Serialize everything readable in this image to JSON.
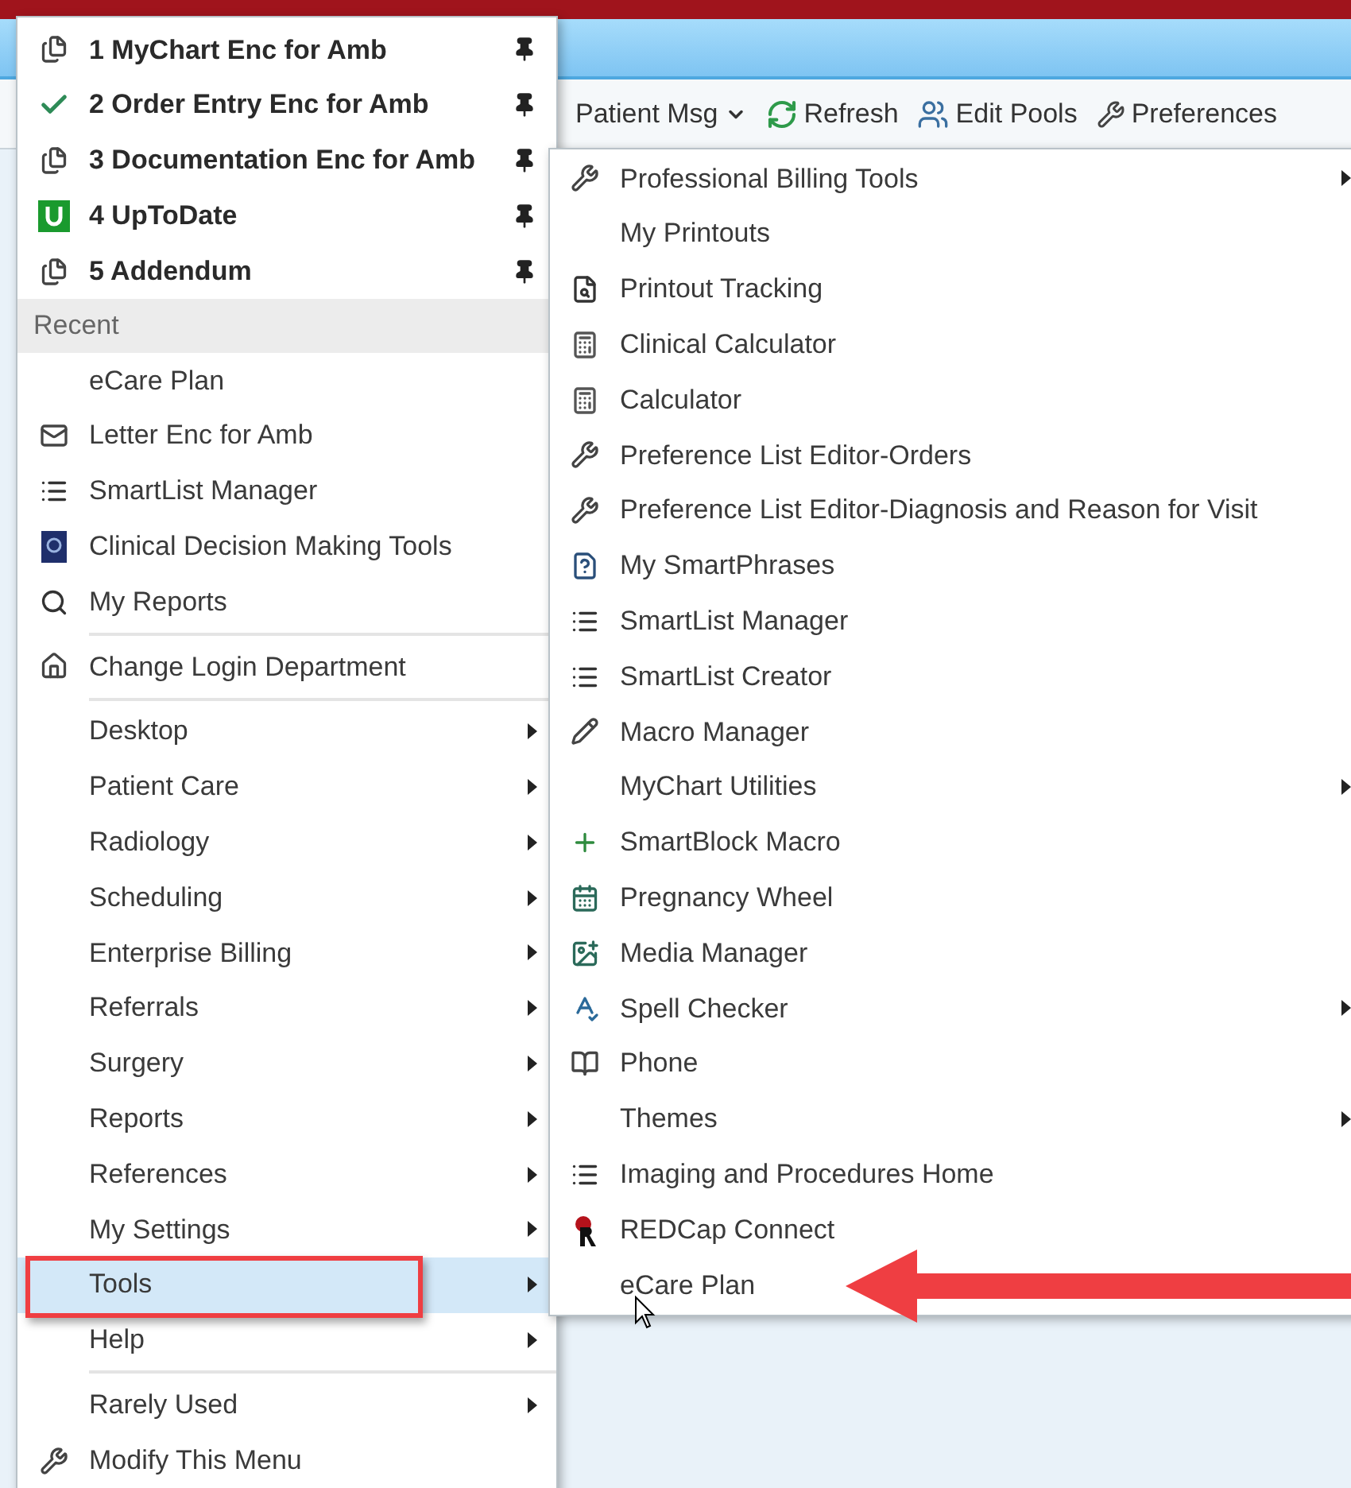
{
  "toolbar": {
    "items": [
      {
        "label": "Patient Msg",
        "kind": "dropdown"
      },
      {
        "label": "Refresh",
        "kind": "button"
      },
      {
        "label": "Edit Pools",
        "kind": "button"
      },
      {
        "label": "Preferences",
        "kind": "button"
      }
    ]
  },
  "main_menu": {
    "sections": [
      {
        "items": [
          {
            "label": "1 MyChart Enc for Amb",
            "kind": "pinned",
            "pinned": true,
            "checked": false,
            "selected": false,
            "submenu": false
          },
          {
            "label": "2 Order Entry Enc for Amb",
            "kind": "pinned",
            "pinned": true,
            "checked": true,
            "selected": false,
            "submenu": false
          },
          {
            "label": "3 Documentation Enc for Amb",
            "kind": "pinned",
            "pinned": true,
            "checked": false,
            "selected": false,
            "submenu": false
          },
          {
            "label": "4 UpToDate",
            "kind": "pinned",
            "pinned": true,
            "checked": false,
            "selected": false,
            "submenu": false
          },
          {
            "label": "5 Addendum",
            "kind": "pinned",
            "pinned": true,
            "checked": false,
            "selected": false,
            "submenu": false
          }
        ]
      },
      {
        "header": "Recent",
        "items": [
          {
            "label": "eCare Plan",
            "kind": "item",
            "selected": false,
            "submenu": false
          },
          {
            "label": "Letter Enc for Amb",
            "kind": "item",
            "selected": false,
            "submenu": false
          },
          {
            "label": "SmartList Manager",
            "kind": "item",
            "selected": false,
            "submenu": false
          },
          {
            "label": "Clinical Decision Making Tools",
            "kind": "item",
            "selected": false,
            "submenu": false
          },
          {
            "label": "My Reports",
            "kind": "item",
            "selected": false,
            "submenu": false
          }
        ]
      },
      {
        "items": [
          {
            "label": "Change Login Department",
            "kind": "item",
            "selected": false,
            "submenu": false
          }
        ]
      },
      {
        "items": [
          {
            "label": "Desktop",
            "kind": "item",
            "selected": false,
            "submenu": true
          },
          {
            "label": "Patient Care",
            "kind": "item",
            "selected": false,
            "submenu": true
          },
          {
            "label": "Radiology",
            "kind": "item",
            "selected": false,
            "submenu": true
          },
          {
            "label": "Scheduling",
            "kind": "item",
            "selected": false,
            "submenu": true
          },
          {
            "label": "Enterprise Billing",
            "kind": "item",
            "selected": false,
            "submenu": true
          },
          {
            "label": "Referrals",
            "kind": "item",
            "selected": false,
            "submenu": true
          },
          {
            "label": "Surgery",
            "kind": "item",
            "selected": false,
            "submenu": true
          },
          {
            "label": "Reports",
            "kind": "item",
            "selected": false,
            "submenu": true
          },
          {
            "label": "References",
            "kind": "item",
            "selected": false,
            "submenu": true
          },
          {
            "label": "My Settings",
            "kind": "item",
            "selected": false,
            "submenu": true
          },
          {
            "label": "Tools",
            "kind": "item",
            "selected": true,
            "submenu": true
          },
          {
            "label": "Help",
            "kind": "item",
            "selected": false,
            "submenu": true
          }
        ]
      },
      {
        "items": [
          {
            "label": "Rarely Used",
            "kind": "item",
            "selected": false,
            "submenu": true
          },
          {
            "label": "Modify This Menu",
            "kind": "item",
            "selected": false,
            "submenu": false
          }
        ]
      }
    ]
  },
  "tools_submenu": {
    "items": [
      {
        "label": "Professional Billing Tools",
        "selected": false,
        "submenu": true
      },
      {
        "label": "My Printouts",
        "selected": false,
        "submenu": false
      },
      {
        "label": "Printout Tracking",
        "selected": false,
        "submenu": false
      },
      {
        "label": "Clinical Calculator",
        "selected": false,
        "submenu": false
      },
      {
        "label": "Calculator",
        "selected": false,
        "submenu": false
      },
      {
        "label": "Preference List Editor-Orders",
        "selected": false,
        "submenu": false
      },
      {
        "label": "Preference List Editor-Diagnosis and Reason for Visit",
        "selected": false,
        "submenu": false
      },
      {
        "label": "My SmartPhrases",
        "selected": false,
        "submenu": false
      },
      {
        "label": "SmartList Manager",
        "selected": false,
        "submenu": false
      },
      {
        "label": "SmartList Creator",
        "selected": false,
        "submenu": false
      },
      {
        "label": "Macro Manager",
        "selected": false,
        "submenu": false
      },
      {
        "label": "MyChart Utilities",
        "selected": false,
        "submenu": true
      },
      {
        "label": "SmartBlock Macro",
        "selected": false,
        "submenu": false
      },
      {
        "label": "Pregnancy Wheel",
        "selected": false,
        "submenu": false
      },
      {
        "label": "Media Manager",
        "selected": false,
        "submenu": false
      },
      {
        "label": "Spell Checker",
        "selected": false,
        "submenu": true
      },
      {
        "label": "Phone",
        "selected": false,
        "submenu": false
      },
      {
        "label": "Themes",
        "selected": false,
        "submenu": true
      },
      {
        "label": "Imaging and Procedures Home",
        "selected": false,
        "submenu": false
      },
      {
        "label": "REDCap Connect",
        "selected": false,
        "submenu": false
      },
      {
        "label": "eCare Plan",
        "selected": false,
        "submenu": false
      }
    ]
  }
}
